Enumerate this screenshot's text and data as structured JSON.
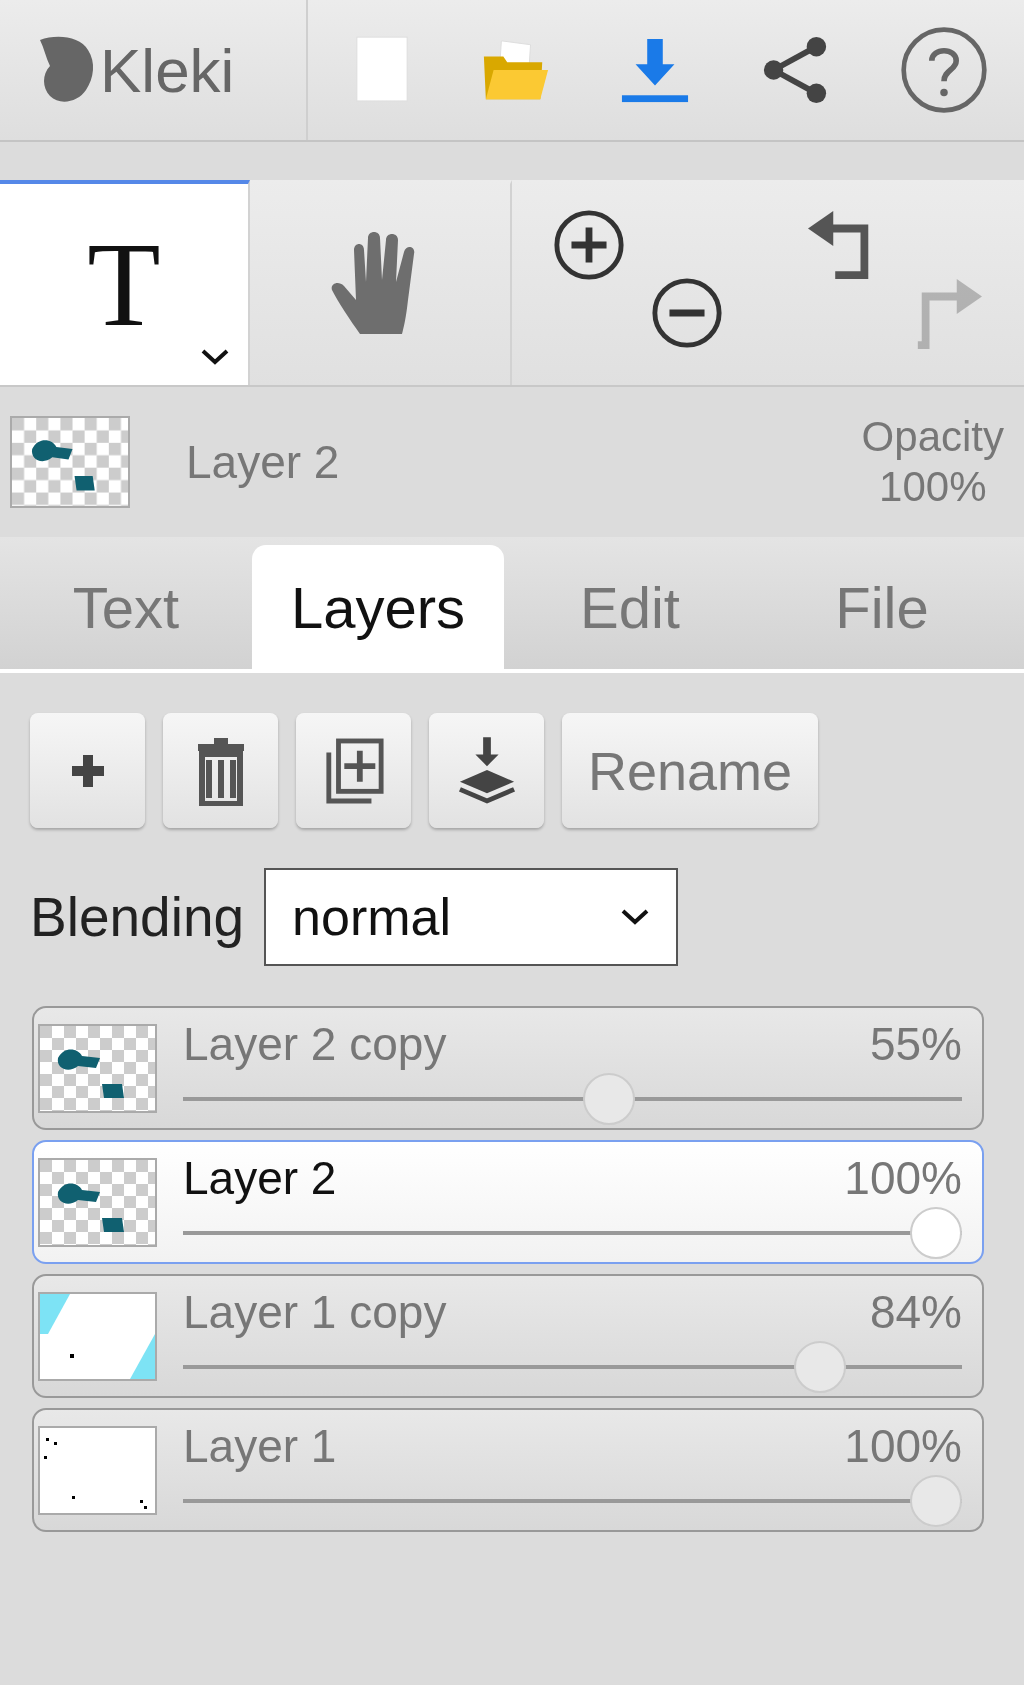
{
  "header": {
    "logo_text": "Kleki",
    "actions": [
      {
        "kind": "new",
        "disabled": false
      },
      {
        "kind": "open",
        "disabled": false
      },
      {
        "kind": "download",
        "disabled": false
      },
      {
        "kind": "share",
        "disabled": false
      },
      {
        "kind": "help",
        "disabled": false
      }
    ]
  },
  "tools": [
    {
      "kind": "text",
      "glyph": "T",
      "selected": true
    },
    {
      "kind": "hand",
      "selected": false
    }
  ],
  "view_actions": [
    {
      "kind": "zoom-in",
      "disabled": false
    },
    {
      "kind": "zoom-out",
      "disabled": false
    },
    {
      "kind": "undo",
      "disabled": false
    },
    {
      "kind": "redo",
      "disabled": true
    }
  ],
  "current_layer": {
    "name": "Layer 2",
    "opacity_label": "Opacity",
    "opacity": "100%",
    "thumbnail": {
      "kind": "text"
    }
  },
  "tabs": [
    {
      "label": "Text",
      "selected": false
    },
    {
      "label": "Layers",
      "selected": true
    },
    {
      "label": "Edit",
      "selected": false
    },
    {
      "label": "File",
      "selected": false
    }
  ],
  "layer_actions": [
    {
      "kind": "add"
    },
    {
      "kind": "delete"
    },
    {
      "kind": "duplicate"
    },
    {
      "kind": "merge"
    },
    {
      "kind": "rename",
      "label": "Rename"
    }
  ],
  "blending": {
    "label": "Blending",
    "value": "normal"
  },
  "layers": [
    {
      "name": "Layer 2 copy",
      "opacity": "55%",
      "level": 0.55,
      "selected": false,
      "thumbnail": {
        "kind": "text"
      }
    },
    {
      "name": "Layer 2",
      "opacity": "100%",
      "level": 1,
      "selected": true,
      "thumbnail": {
        "kind": "text"
      }
    },
    {
      "name": "Layer 1 copy",
      "opacity": "84%",
      "level": 0.84,
      "selected": false,
      "thumbnail": {
        "kind": "cyan"
      }
    },
    {
      "name": "Layer 1",
      "opacity": "100%",
      "level": 1,
      "selected": false,
      "thumbnail": {
        "kind": "dots"
      }
    }
  ]
}
